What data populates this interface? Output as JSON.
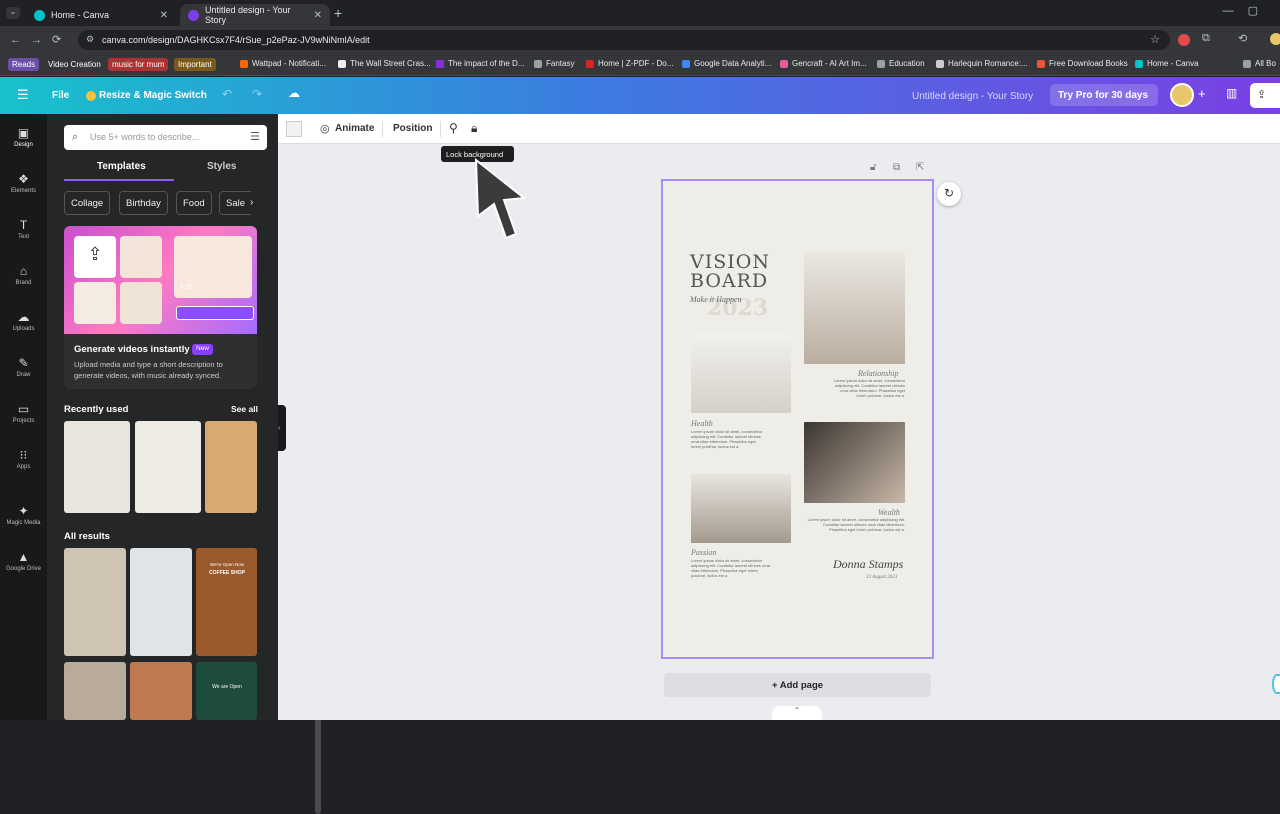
{
  "browser": {
    "tabs": [
      {
        "title": "Home - Canva"
      },
      {
        "title": "Untitled design - Your Story"
      }
    ],
    "url": "canva.com/design/DAGHKCsx7F4/rSue_p2ePaz-JV9wNiNmlA/edit",
    "bookmarks": {
      "chips": [
        "Reads",
        "Video Creation",
        "music for mum",
        "Important"
      ],
      "links": [
        "Wattpad - Notificati...",
        "The Wall Street Cras...",
        "The impact of the D...",
        "Fantasy",
        "Home | Z-PDF - Do...",
        "Google Data Analyti...",
        "Gencraft - AI Art Im...",
        "Education",
        "Harlequin Romance:...",
        "Free Download Books",
        "Home - Canva",
        "All Bo"
      ]
    }
  },
  "header": {
    "file": "File",
    "resize": "Resize & Magic Switch",
    "doc_title": "Untitled design - Your Story",
    "try_pro": "Try Pro for 30 days"
  },
  "rail": [
    "Design",
    "Elements",
    "Text",
    "Brand",
    "Uploads",
    "Draw",
    "Projects",
    "Apps",
    "Magic Media",
    "Google Drive"
  ],
  "panel": {
    "search_placeholder": "Use 5+ words to describe...",
    "tabs": [
      "Templates",
      "Styles"
    ],
    "categories": [
      "Collage",
      "Birthday",
      "Food",
      "Sale"
    ],
    "promo": {
      "title": "Generate videos instantly",
      "badge": "New",
      "desc": "Upload media and type a short description to generate videos, with music already synced.",
      "duration": "4.0s"
    },
    "recent": "Recently used",
    "see_all": "See all",
    "all_results": "All results",
    "thumb_labels": [
      "COFFEE SHOP",
      "We're Open Now",
      "We are Open"
    ]
  },
  "context_bar": {
    "animate": "Animate",
    "position": "Position",
    "tooltip": "Lock background"
  },
  "design": {
    "title1": "VISION",
    "title2": "BOARD",
    "year": "2023",
    "script": "Make it Happen",
    "captions": [
      "Relationship",
      "Health",
      "Wealth",
      "Passion"
    ],
    "lorem": "Lorem ipsum dolor sit amet, consectetur adipiscing elit. Curabitur laoreet ultrices urna vitae bibendum. Phasellus eget lorem pulvinar, luctus est a.",
    "signature": "Donna Stamps",
    "date": "23 August 2023"
  },
  "add_page": "+ Add page"
}
